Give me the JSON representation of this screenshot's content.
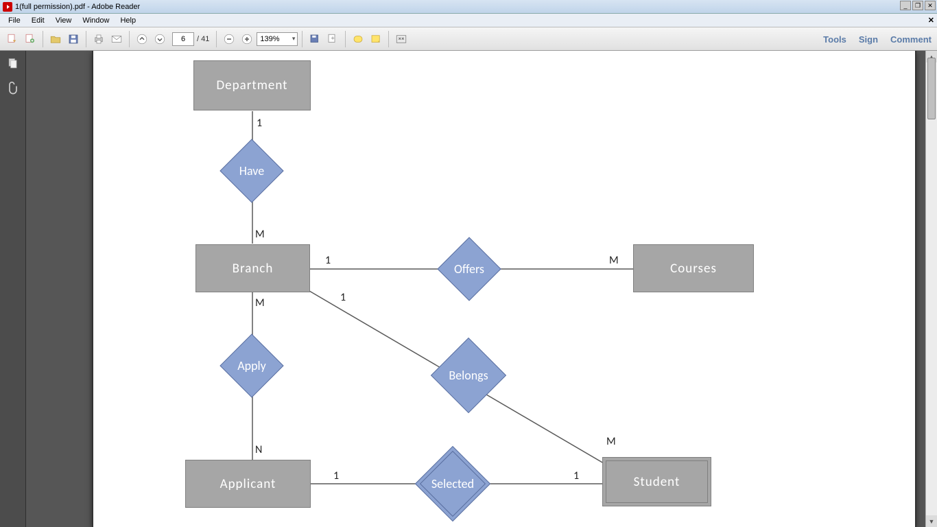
{
  "window": {
    "title": "1(full permission).pdf - Adobe Reader"
  },
  "menu": {
    "items": [
      "File",
      "Edit",
      "View",
      "Window",
      "Help"
    ]
  },
  "toolbar": {
    "page_current": "6",
    "page_total": "/ 41",
    "zoom": "139%",
    "right": {
      "tools": "Tools",
      "sign": "Sign",
      "comment": "Comment"
    }
  },
  "diagram": {
    "entities": {
      "department": "Department",
      "branch": "Branch",
      "courses": "Courses",
      "applicant": "Applicant",
      "student": "Student"
    },
    "relations": {
      "have": "Have",
      "offers": "Offers",
      "apply": "Apply",
      "belongs": "Belongs",
      "selected": "Selected"
    },
    "card": {
      "dep_have": "1",
      "have_branch": "M",
      "branch_offers": "1",
      "offers_courses": "M",
      "branch_apply": "M",
      "apply_applicant": "N",
      "branch_belongs": "1",
      "belongs_student": "M",
      "applicant_selected": "1",
      "selected_student": "1"
    }
  }
}
